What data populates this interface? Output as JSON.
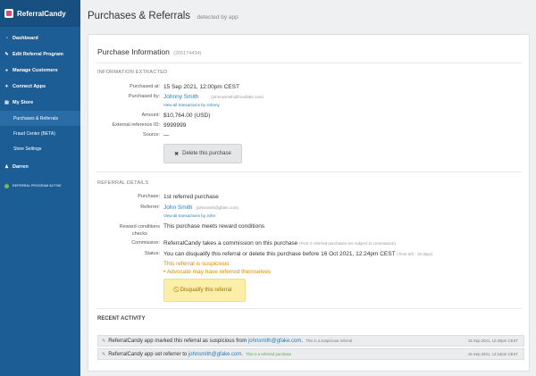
{
  "brand": {
    "name": "ReferralCandy"
  },
  "sidebar": {
    "items": [
      {
        "label": "Dashboard",
        "icon": "dashboard-icon"
      },
      {
        "label": "Edit Referral Program",
        "icon": "edit-icon"
      },
      {
        "label": "Manage Customers",
        "icon": "users-icon"
      },
      {
        "label": "Connect Apps",
        "icon": "plug-icon"
      },
      {
        "label": "My Store",
        "icon": "store-icon"
      }
    ],
    "subitems": [
      {
        "label": "Purchases & Referrals",
        "active": true
      },
      {
        "label": "Fraud Center (BETA)"
      },
      {
        "label": "Store Settings"
      }
    ],
    "user": {
      "label": "Darren",
      "icon": "user-icon"
    },
    "status": {
      "label": "REFERRAL PROGRAM ACTIVE",
      "color": "#6fbf4a"
    }
  },
  "header": {
    "title": "Purchases & Referrals",
    "subtitle": "detected by app"
  },
  "card": {
    "title": "Purchase Information",
    "id": "(205174434)",
    "info_section": {
      "label": "INFORMATION EXTRACTED",
      "purchased_at": {
        "label": "Purchased at:",
        "value": "15 Sep 2021, 12:00pm CEST"
      },
      "purchased_by": {
        "label": "Purchased by:",
        "name": "Johnny Smith",
        "email": "(johnnysmith@fooofake.com)",
        "link": "View all transactions by Johnny"
      },
      "amount": {
        "label": "Amount:",
        "value": "$10,764.00 (USD)"
      },
      "external_ref": {
        "label": "External reference ID:",
        "value": "9999999"
      },
      "source": {
        "label": "Source:",
        "value": "—"
      },
      "delete_button": "Delete this purchase"
    },
    "referral_section": {
      "label": "REFERRAL DETAILS",
      "purchase": {
        "label": "Purchase:",
        "value": "1st referred purchase"
      },
      "referrer": {
        "label": "Referrer:",
        "name": "John Smith",
        "email": "(johnsmith@gfake.com)",
        "link": "View all transactions by John"
      },
      "reward": {
        "label_line1": "Reward conditions",
        "label_line2": "checks",
        "value": "This purchase meets reward conditions"
      },
      "commission": {
        "label": "Commission:",
        "value": "ReferralCandy takes a commission on this purchase",
        "note": "(First 3 referred purchases are subject to commission)"
      },
      "status": {
        "label": "Status:",
        "value": "You can disqualify this referral or delete this purchase before 16 Oct 2021, 12:24pm CEST",
        "time_left": "(Time left - 18 days)",
        "suspicious_title": "This referral is suspicious:",
        "suspicious_reason": "• Advocate may have referred themselves"
      },
      "disqualify_button": "Disqualify this referral"
    },
    "activity": {
      "title": "RECENT ACTIVITY",
      "items": [
        {
          "prefix": "ReferralCandy app marked this referral as suspicious from",
          "email": "johnsmith@gfake.com",
          "suffix": ".",
          "note": "This is a suspicious referral",
          "time": "15 Sep 2021, 12:40pm CEST"
        },
        {
          "prefix": "ReferralCandy app set referrer to",
          "email": "johnsmith@gfake.com",
          "suffix": ".",
          "note": "This is a referred purchase",
          "time": "15 Sep 2021, 12:24pm CEST"
        }
      ]
    }
  }
}
